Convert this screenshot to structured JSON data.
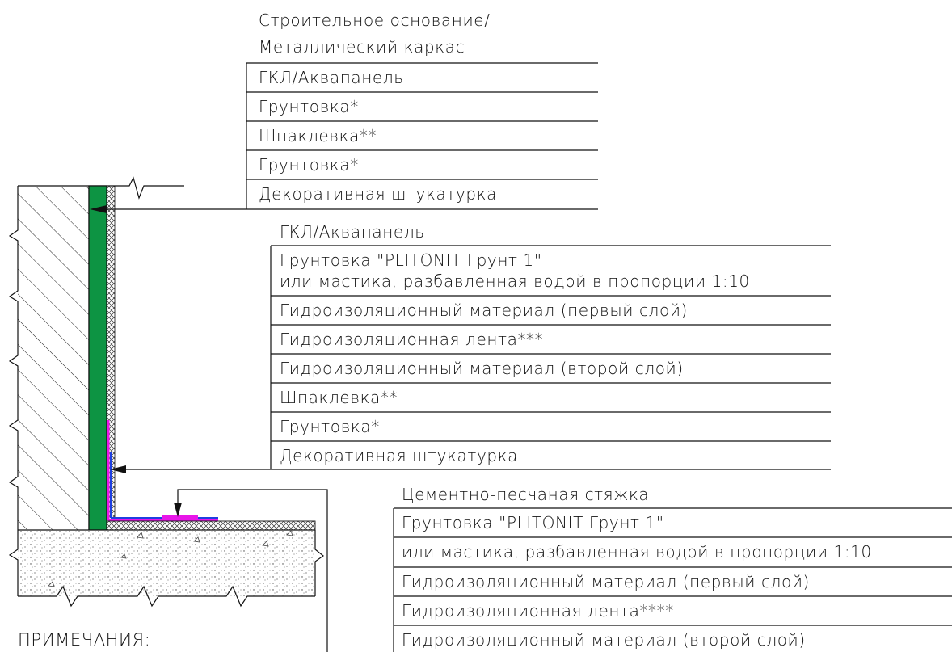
{
  "block1": {
    "title_lines": [
      "Строительное основание/",
      "Металлический каркас"
    ],
    "layers": [
      "ГКЛ/Аквапанель",
      "Грунтовка*",
      "Шпаклевка**",
      "Грунтовка*",
      "Декоративная штукатурка"
    ]
  },
  "block2": {
    "title": "ГКЛ/Аквапанель",
    "layers": [
      {
        "line1": "Грунтовка \"PLITONIT Грунт 1\"",
        "line2": "или мастика, разбавленная водой в пропорции 1:10"
      },
      {
        "line1": "Гидроизоляционный материал (первый слой)"
      },
      {
        "line1": "Гидроизоляционная лента***"
      },
      {
        "line1": "Гидроизоляционный материал (второй слой)"
      },
      {
        "line1": "Шпаклевка**"
      },
      {
        "line1": "Грунтовка*"
      },
      {
        "line1": "Декоративная штукатурка"
      }
    ]
  },
  "block3": {
    "title": "Цементно-песчаная стяжка",
    "layers": [
      "Грунтовка \"PLITONIT Грунт 1\"",
      "или мастика, разбавленная водой в пропорции 1:10",
      "Гидроизоляционный материал (первый слой)",
      "Гидроизоляционная лента****",
      "Гидроизоляционный материал (второй слой)"
    ]
  },
  "notes": {
    "heading": "ПРИМЕЧАНИЯ:"
  },
  "colors": {
    "gkl_board": "#0d9443",
    "membrane_magenta": "#e815e8",
    "membrane_blue": "#1d3fe0",
    "line": "#111111"
  }
}
